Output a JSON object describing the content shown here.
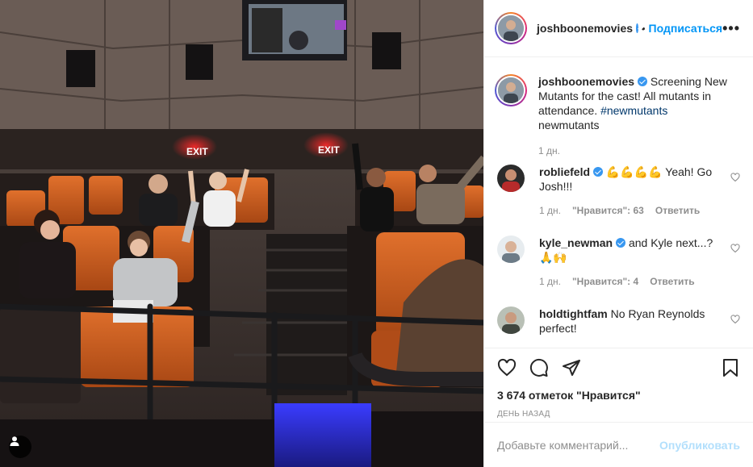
{
  "photo": {
    "exit_sign_left": "EXIT",
    "exit_sign_right": "EXIT",
    "user_tag_icon": "user-icon"
  },
  "post": {
    "author": "joshboonemovies",
    "separator": "•",
    "follow_label": "Подписаться",
    "more_icon": "more-options-icon",
    "more_label": "•••"
  },
  "caption": {
    "username": "joshboonemovies",
    "text": "Screening New Mutants for the cast! All mutants in attendance.",
    "hashtag": "#newmutants",
    "extra": "newmutants",
    "time": "1 дн."
  },
  "comments": [
    {
      "username": "robliefeld",
      "verified": true,
      "text": "💪💪💪💪 Yeah! Go Josh!!!",
      "time": "1 дн.",
      "likes": "\"Нравится\": 63",
      "reply": "Ответить"
    },
    {
      "username": "kyle_newman",
      "verified": true,
      "text": "and Kyle next...? 🙏🙌",
      "time": "1 дн.",
      "likes": "\"Нравится\": 4",
      "reply": "Ответить"
    },
    {
      "username": "holdtightfam",
      "verified": false,
      "text": "No Ryan Reynolds perfect!",
      "time": "",
      "likes": "",
      "reply": ""
    }
  ],
  "actions": {
    "like_icon": "heart-icon",
    "comment_icon": "comment-icon",
    "share_icon": "share-icon",
    "save_icon": "bookmark-icon",
    "likes_count": "3 674 отметок \"Нравится\"",
    "date": "ДЕНЬ НАЗАД"
  },
  "add_comment": {
    "placeholder": "Добавьте комментарий...",
    "publish_label": "Опубликовать"
  },
  "colors": {
    "accent": "#0095f6",
    "verified": "#3897f0",
    "publish_disabled": "#b2dffc",
    "muted": "#8e8e8e"
  }
}
